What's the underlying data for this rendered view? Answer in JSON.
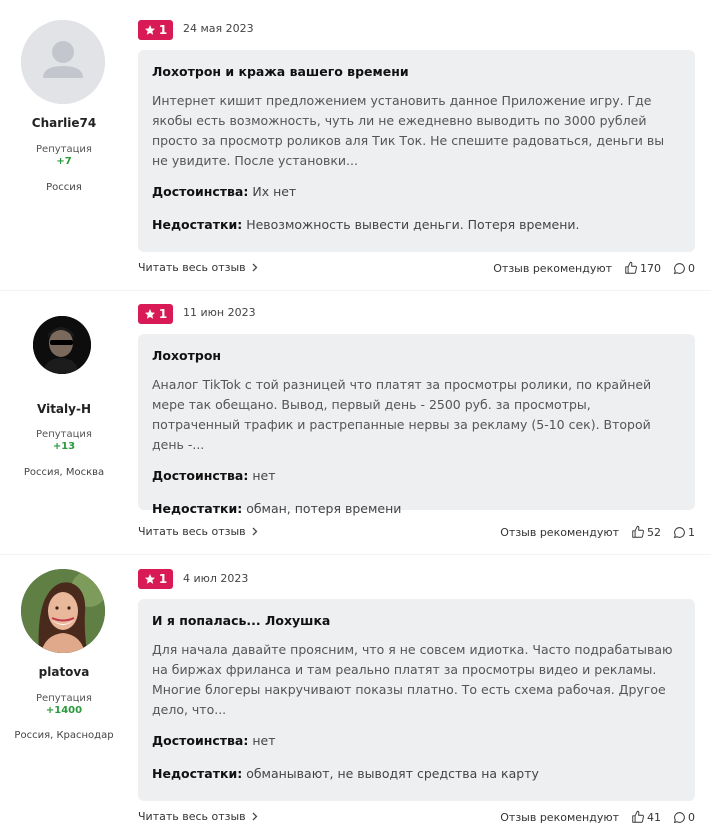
{
  "reviews": [
    {
      "author": "Charlie74",
      "rep_label": "Репутация",
      "rep": "+7",
      "location": "Россия",
      "rating": "1",
      "date": "24 мая 2023",
      "title": "Лохотрон и кража вашего времени",
      "text": "Интернет кишит предложением установить данное Приложение игру. Где якобы есть возможность, чуть ли не ежедневно выводить по 3000 рублей просто за просмотр роликов аля Тик Ток. Не спешите радоваться, деньги вы не увидите. После установки...",
      "pros_label": "Достоинства:",
      "pros": "Их нет",
      "cons_label": "Недостатки:",
      "cons": "Невозможность вывести деньги. Потеря времени.",
      "read_more": "Читать весь отзыв",
      "recommend": "Отзыв рекомендуют",
      "likes": "170",
      "comments": "0"
    },
    {
      "author": "Vitaly-H",
      "rep_label": "Репутация",
      "rep": "+13",
      "location": "Россия, Москва",
      "rating": "1",
      "date": "11 июн 2023",
      "title": "Лохотрон",
      "text": "Аналог TikTok с той разницей что платят за просмотры ролики, по крайней мере так обещано. Вывод, первый день - 2500 руб. за просмотры, потраченный трафик и растрепанные нервы за рекламу (5-10 сек). Второй день -...",
      "pros_label": "Достоинства:",
      "pros": "нет",
      "cons_label": "Недостатки:",
      "cons": "обман, потеря времени",
      "read_more": "Читать весь отзыв",
      "recommend": "Отзыв рекомендуют",
      "likes": "52",
      "comments": "1"
    },
    {
      "author": "platova",
      "rep_label": "Репутация",
      "rep": "+1400",
      "location": "Россия, Краснодар",
      "rating": "1",
      "date": "4 июл 2023",
      "title": "И я попалась... Лохушка",
      "text": "Для начала давайте проясним, что я не совсем идиотка. Часто подрабатываю на биржах фриланса и там реально платят за просмотры видео и рекламы. Многие блогеры накручивают показы платно. То есть схема рабочая. Другое дело, что...",
      "pros_label": "Достоинства:",
      "pros": "нет",
      "cons_label": "Недостатки:",
      "cons": "обманывают, не выводят средства на карту",
      "read_more": "Читать весь отзыв",
      "recommend": "Отзыв рекомендуют",
      "likes": "41",
      "comments": "0"
    }
  ],
  "colors": {
    "badge": "#d81b56",
    "rep": "#2a9a3c",
    "card": "#eeeff1"
  },
  "icons": [
    "user-placeholder-icon",
    "star-icon",
    "chevron-right-icon",
    "thumbs-up-icon",
    "comment-icon"
  ]
}
